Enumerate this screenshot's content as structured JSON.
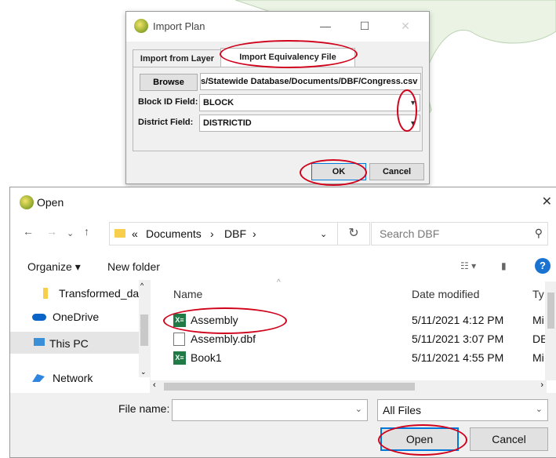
{
  "import_plan": {
    "title": "Import Plan",
    "tabs": [
      "Import from Layer",
      "Import Equivalency File"
    ],
    "browse_label": "Browse",
    "file_path": "s/Statewide Database/Documents/DBF/Congress.csv",
    "block_id_label": "Block ID Field:",
    "block_id_value": "BLOCK",
    "district_label": "District Field:",
    "district_value": "DISTRICTID",
    "ok_label": "OK",
    "cancel_label": "Cancel"
  },
  "open_dialog": {
    "title": "Open",
    "breadcrumb": [
      "«",
      "Documents",
      "›",
      "DBF",
      "›"
    ],
    "search_placeholder": "Search DBF",
    "organize_label": "Organize ▾",
    "new_folder_label": "New folder",
    "nav_items": [
      {
        "label": "Transformed_dat",
        "icon": "folder-icon"
      },
      {
        "label": "OneDrive",
        "icon": "onedrive-icon"
      },
      {
        "label": "This PC",
        "icon": "computer-icon"
      },
      {
        "label": "Network",
        "icon": "network-icon"
      }
    ],
    "columns": {
      "name": "Name",
      "date": "Date modified",
      "type": "Ty"
    },
    "files": [
      {
        "name": "Assembly",
        "date": "5/11/2021 4:12 PM",
        "type": "Mi",
        "icon": "excel-icon"
      },
      {
        "name": "Assembly.dbf",
        "date": "5/11/2021 3:07 PM",
        "type": "DE",
        "icon": "file-icon"
      },
      {
        "name": "Book1",
        "date": "5/11/2021 4:55 PM",
        "type": "Mi",
        "icon": "excel-icon"
      }
    ],
    "file_name_label": "File name:",
    "file_name_value": "",
    "filter_value": "All Files",
    "open_label": "Open",
    "cancel_label": "Cancel"
  },
  "colors": {
    "annotation": "#d0021b",
    "accent": "#0078d7"
  }
}
